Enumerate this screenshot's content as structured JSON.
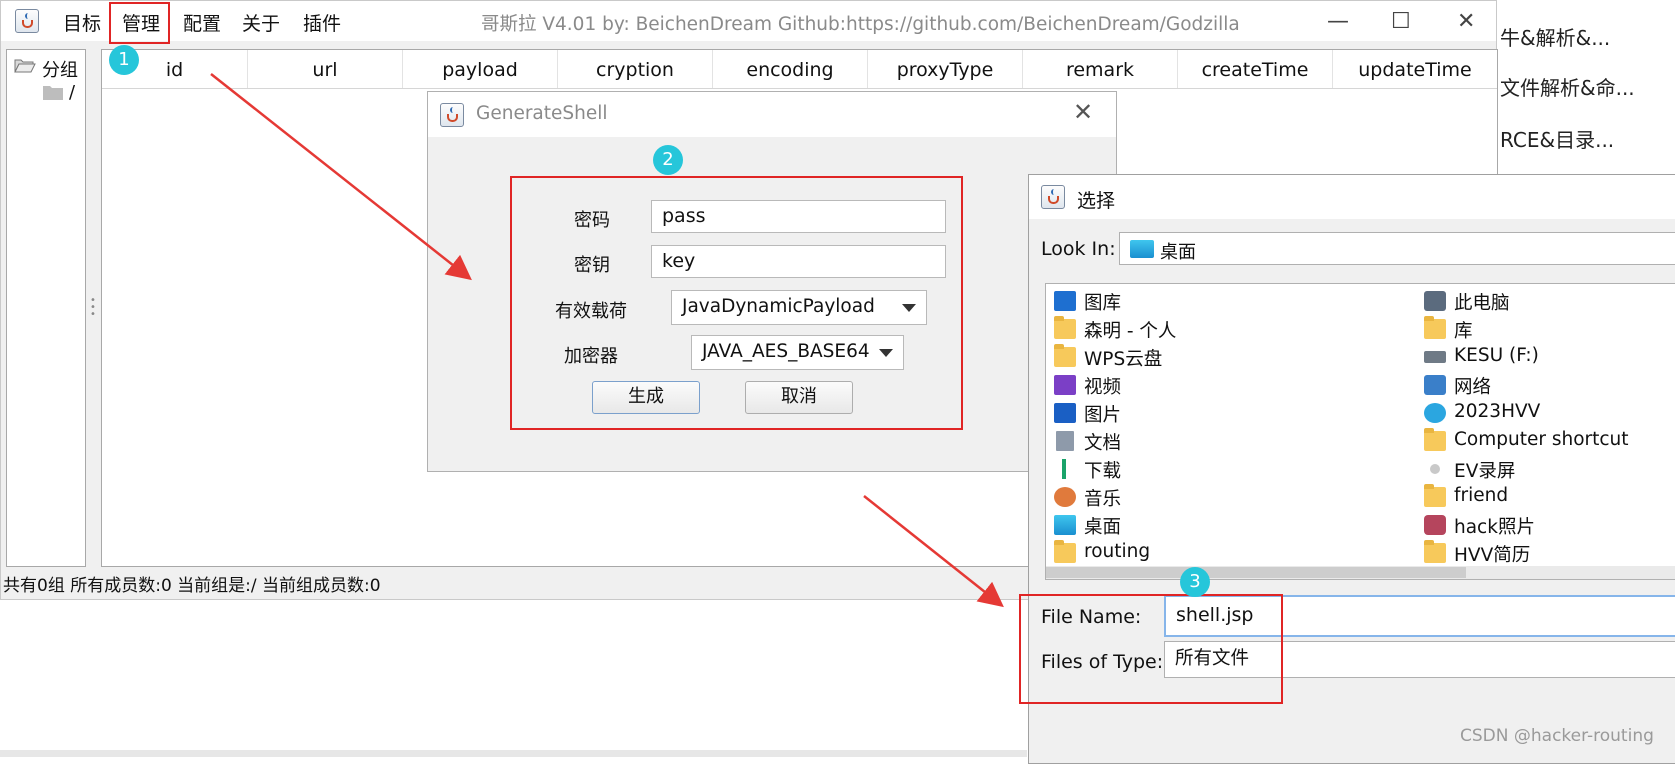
{
  "main_window": {
    "title": "哥斯拉   V4.01 by: BeichenDream Github:https://github.com/BeichenDream/Godzilla",
    "menu": [
      "目标",
      "管理",
      "配置",
      "关于",
      "插件"
    ],
    "controls": {
      "minimize": "—",
      "maximize": "☐",
      "close": "✕"
    },
    "tree": {
      "root_label": "分组",
      "child_label": "/"
    },
    "table_columns": [
      "id",
      "url",
      "payload",
      "cryption",
      "encoding",
      "proxyType",
      "remark",
      "createTime",
      "updateTime"
    ],
    "status_text": "共有0组 所有成员数:0 当前组是:/ 当前组成员数:0"
  },
  "background_window": {
    "lines": [
      "牛&解析&...",
      "文件解析&命...",
      "RCE&目录..."
    ]
  },
  "badges": [
    "1",
    "2",
    "3"
  ],
  "generate_shell_dialog": {
    "title": "GenerateShell",
    "close_glyph": "✕",
    "password_label": "密码",
    "password_value": "pass",
    "key_label": "密钥",
    "key_value": "key",
    "payload_label": "有效载荷",
    "payload_value": "JavaDynamicPayload",
    "encryptor_label": "加密器",
    "encryptor_value": "JAVA_AES_BASE64",
    "generate_button": "生成",
    "cancel_button": "取消"
  },
  "file_chooser": {
    "title": "选择",
    "look_in_label": "Look In:",
    "look_in_value": "桌面",
    "left_items": [
      "图库",
      "森明 - 个人",
      "WPS云盘",
      "视频",
      "图片",
      "文档",
      "下载",
      "音乐",
      "桌面",
      "routing"
    ],
    "right_items": [
      "此电脑",
      "库",
      "KESU (F:)",
      "网络",
      "2023HVV",
      "Computer shortcut",
      "EV录屏",
      "friend",
      "hack照片",
      "HVV简历"
    ],
    "file_name_label": "File Name:",
    "file_name_value": "shell.jsp",
    "file_type_label": "Files of Type:",
    "file_type_value": "所有文件"
  },
  "watermark": "CSDN @hacker-routing",
  "colors": {
    "highlight_red": "#e02525",
    "badge_cyan": "#26c6da",
    "arrow_red": "#e53935"
  }
}
